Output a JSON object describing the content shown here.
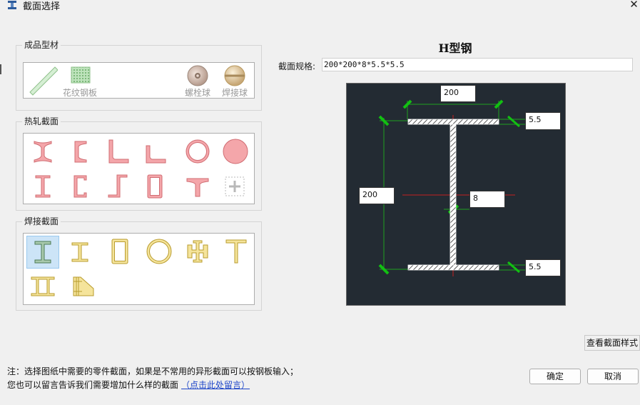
{
  "window": {
    "title": "截面选择",
    "close_glyph": "✕"
  },
  "groups": {
    "finished": {
      "title": "成品型材",
      "items": [
        {
          "icon": "flat-bar-icon",
          "label": ""
        },
        {
          "icon": "checkered-plate-icon",
          "label": "花纹钢板"
        },
        {
          "icon": "bolt-ball-icon",
          "label": "螺栓球"
        },
        {
          "icon": "weld-ball-icon",
          "label": "焊接球"
        }
      ]
    },
    "hot_rolled": {
      "title": "热轧截面",
      "items": [
        {
          "icon": "hot-i-beam-icon"
        },
        {
          "icon": "hot-channel-icon"
        },
        {
          "icon": "hot-equal-angle-icon"
        },
        {
          "icon": "hot-unequal-angle-icon"
        },
        {
          "icon": "hot-pipe-icon"
        },
        {
          "icon": "hot-round-bar-icon"
        },
        {
          "icon": "cold-i-icon"
        },
        {
          "icon": "cold-channel-icon"
        },
        {
          "icon": "z-section-icon"
        },
        {
          "icon": "rect-tube-icon"
        },
        {
          "icon": "t-section-icon"
        },
        {
          "icon": "add-custom-icon"
        }
      ]
    },
    "welded": {
      "title": "焊接截面",
      "items": [
        {
          "icon": "welded-h-icon",
          "selected": true
        },
        {
          "icon": "welded-i-icon"
        },
        {
          "icon": "welded-box-icon"
        },
        {
          "icon": "welded-pipe-icon"
        },
        {
          "icon": "welded-cross-icon"
        },
        {
          "icon": "welded-t-icon"
        },
        {
          "icon": "welded-double-h-icon"
        },
        {
          "icon": "welded-tapered-icon"
        }
      ]
    }
  },
  "detail": {
    "section_title": "H型钢",
    "spec_label": "截面规格:",
    "spec_value": "200*200*8*5.5*5.5",
    "dims": {
      "width": "200",
      "height": "200",
      "web": "8",
      "top_flange": "5.5",
      "bottom_flange": "5.5"
    }
  },
  "buttons": {
    "view_style": "查看截面样式",
    "ok": "确定",
    "cancel": "取消"
  },
  "notes": {
    "line1": "注：选择图纸中需要的零件截面，如果是不常用的异形截面可以按钢板输入；",
    "line2": "您也可以留言告诉我们需要增加什么样的截面",
    "link": "（点击此处留言）"
  },
  "colors": {
    "hot_rolled_fill": "#f4a6aa",
    "welded_fill": "#f5e49b",
    "dim_line": "#1fa01f",
    "center_line": "#c42020",
    "preview_bg": "#232b33"
  }
}
